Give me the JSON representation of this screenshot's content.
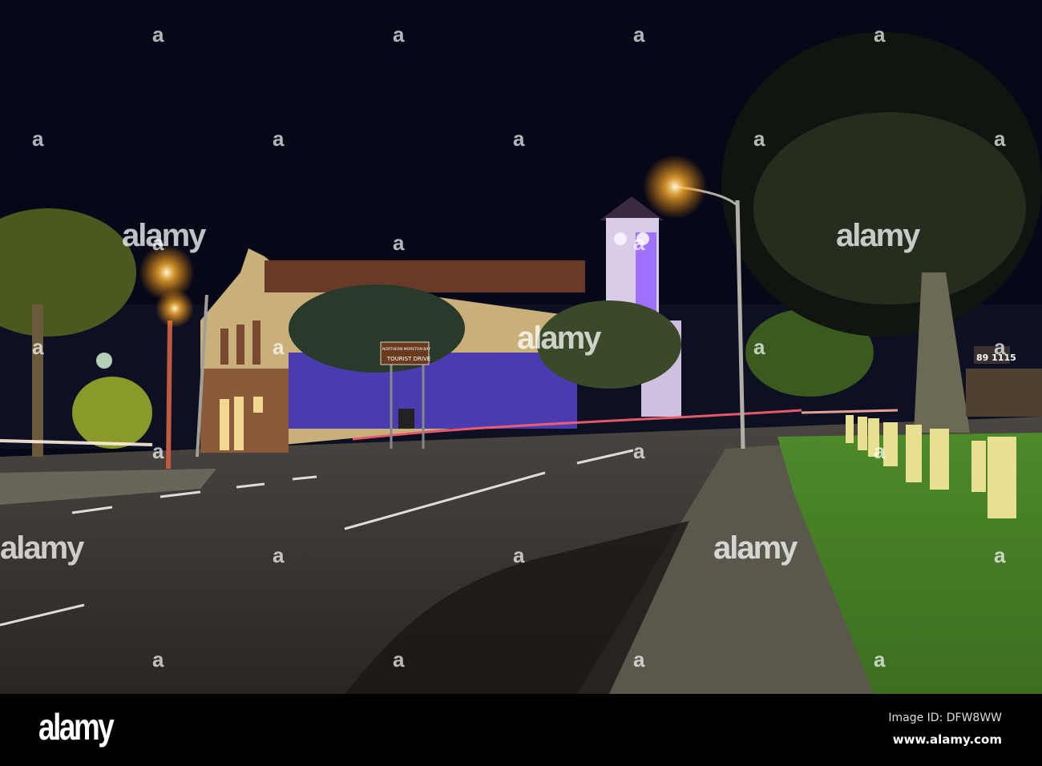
{
  "watermark": {
    "text": "alamy",
    "mark": "a"
  },
  "sign": {
    "line1": "NORTHERN MORETON BAY",
    "line2": "TOURIST DRIVE"
  },
  "shop_sign": "89 1115",
  "footer": {
    "logo": "alamy",
    "image_id": "Image ID: DFW8WW",
    "url": "www.alamy.com"
  }
}
